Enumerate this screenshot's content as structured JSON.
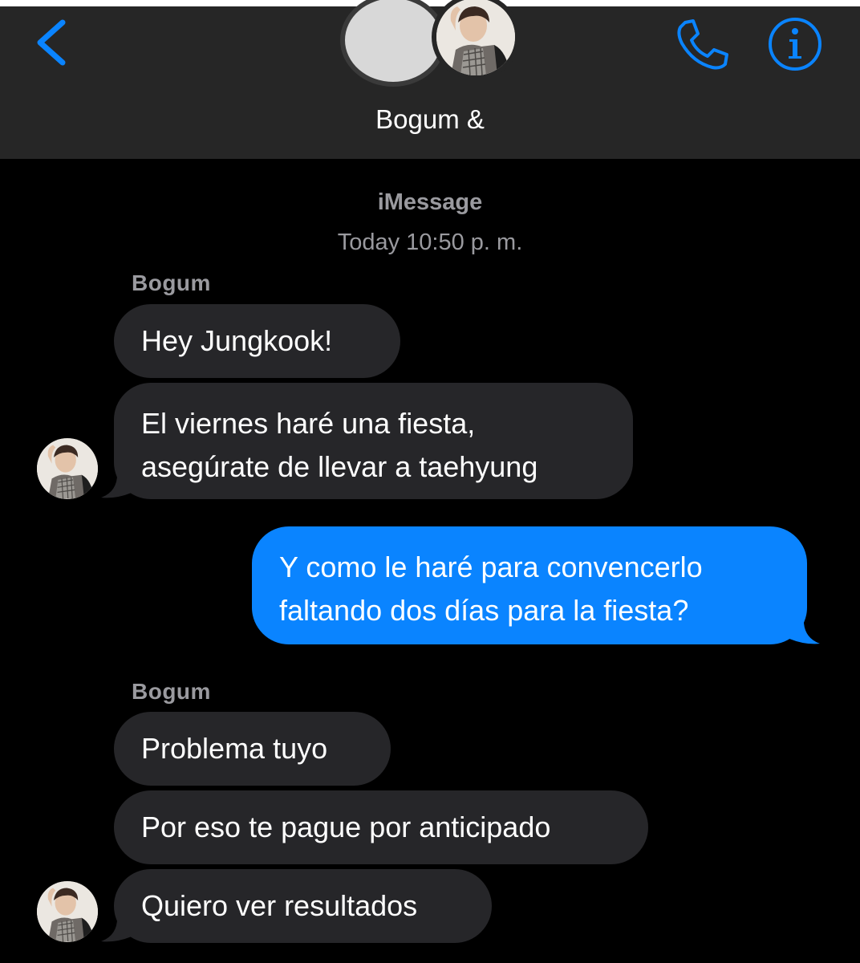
{
  "header": {
    "title": "Bogum &",
    "accent_color": "#0a84ff"
  },
  "conversation": {
    "service": "iMessage",
    "timestamp": "Today 10:50 p. m."
  },
  "groups": [
    {
      "sender": "Bogum",
      "messages": [
        {
          "lines": [
            "Hey Jungkook!"
          ]
        },
        {
          "lines": [
            "El viernes haré una fiesta,",
            "asegúrate de llevar a taehyung"
          ]
        }
      ]
    },
    {
      "sender": "me",
      "messages": [
        {
          "lines": [
            "Y como le haré para convencerlo",
            "faltando dos días para la fiesta?"
          ]
        }
      ]
    },
    {
      "sender": "Bogum",
      "messages": [
        {
          "lines": [
            "Problema tuyo"
          ]
        },
        {
          "lines": [
            "Por eso te pague por anticipado"
          ]
        },
        {
          "lines": [
            "Quiero ver resultados"
          ]
        }
      ]
    }
  ],
  "icons": {
    "back": "chevron-left-icon",
    "call": "phone-icon",
    "info": "info-icon"
  }
}
